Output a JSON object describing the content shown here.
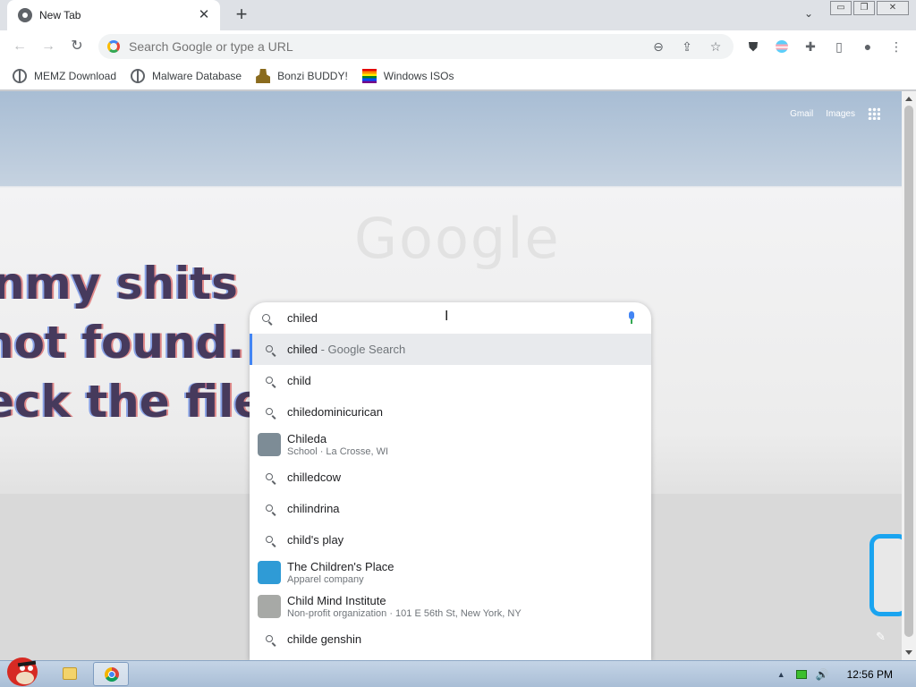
{
  "tab": {
    "title": "New Tab",
    "close": "✕",
    "new_tab": "+"
  },
  "window": {
    "tab_search": "⌄",
    "minimize": "▭",
    "restore": "❐",
    "close": "✕"
  },
  "toolbar": {
    "back": "←",
    "forward": "→",
    "reload": "↻",
    "omnibox_placeholder": "Search Google or type a URL",
    "zoom_icon": "⊖",
    "share_icon": "⇪",
    "star_icon": "☆",
    "extensions": [
      "ublock-origin-icon",
      "flag-extension-icon",
      "extensions-puzzle-icon",
      "side-panel-icon",
      "profile-icon",
      "menu-dots-icon"
    ],
    "puzzle_glyph": "✚",
    "panel_glyph": "▯",
    "profile_glyph": "●",
    "menu_glyph": "⋮",
    "shield_glyph": "⛊"
  },
  "bookmarks": [
    {
      "label": "MEMZ Download",
      "icon": "globe-icon"
    },
    {
      "label": "Malware Database",
      "icon": "globe-icon"
    },
    {
      "label": "Bonzi BUDDY!",
      "icon": "bonzi-icon"
    },
    {
      "label": "Windows ISOs",
      "icon": "rainbow-flag-icon"
    }
  ],
  "ntp": {
    "links": {
      "gmail": "Gmail",
      "images": "Images"
    },
    "logo_text": "Google",
    "background_text": [
      "nmy shits",
      "not found.",
      "eck the file r"
    ],
    "edit_glyph": "✎"
  },
  "search": {
    "query": "chiled",
    "suggestions": [
      {
        "kind": "search",
        "text": "chiled",
        "suffix": " - Google Search",
        "selected": true
      },
      {
        "kind": "search",
        "text": "child"
      },
      {
        "kind": "search",
        "text": "chiledominicurican"
      },
      {
        "kind": "entity",
        "text": "Chileda",
        "sub": "School · La Crosse, WI",
        "thumb_color": "#7d8c96"
      },
      {
        "kind": "search",
        "text": "chilledcow"
      },
      {
        "kind": "search",
        "text": "chilindrina"
      },
      {
        "kind": "search",
        "text": "child's play"
      },
      {
        "kind": "entity",
        "text": "The Children's Place",
        "sub": "Apparel company",
        "thumb_color": "#2f9bd6"
      },
      {
        "kind": "entity",
        "text": "Child Mind Institute",
        "sub": "Non-profit organization · 101 E 56th St, New York, NY",
        "thumb_color": "#a7a9a6"
      },
      {
        "kind": "search",
        "text": "childe genshin"
      }
    ]
  },
  "taskbar": {
    "apps": [
      "start-angry-bird",
      "file-explorer",
      "google-chrome"
    ],
    "tray_arrow": "▲",
    "volume_glyph": "🔊",
    "clock": "12:56 PM"
  },
  "colors": {
    "selected_row": "#e8eaed",
    "accent": "#4285f4"
  }
}
